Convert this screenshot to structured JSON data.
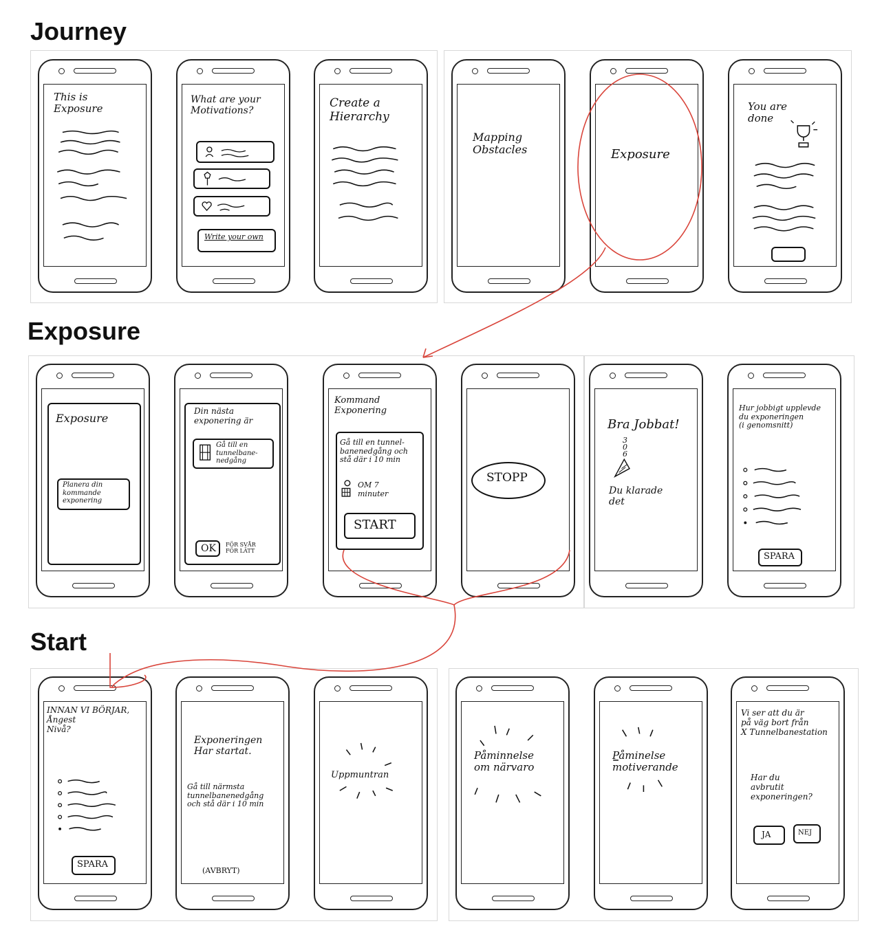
{
  "sections": {
    "journey": "Journey",
    "exposure": "Exposure",
    "start": "Start"
  },
  "accent_color": "#d9443a",
  "journey": {
    "s1_title": "This is\n   Exposure",
    "s2_title": "What are your\n Motivations?",
    "s2_write": "Write your own",
    "s3_title": "Create a\n   Hierarchy",
    "s4_title": "Mapping\n Obstacles",
    "s5_title": "Exposure",
    "s6_title": "You are\n  done"
  },
  "exposure": {
    "s1_title": "Exposure",
    "s1_button": "Planera din\nkommande\nexponering",
    "s2_title": "Din nästa\nexponering är",
    "s2_card": "Gå till en\ntunnelbane-\nnedgång",
    "s2_ok": "OK",
    "s2_options": "FÖR SVÅR\nFÖR LÄTT",
    "s3_title": "Kommand\n  Exponering",
    "s3_task": "Gå till en tunnel-\nbanenedgång och\nstå där i 10 min",
    "s3_timer": "OM 7\nminuter",
    "s3_start": "START",
    "s4_stop": "STOPP",
    "s5_title": "Bra Jobbat!",
    "s5_count": "3\n  0\n    6",
    "s5_sub": "Du klarade\ndet",
    "s6_title": "Hur jobbigt upplevde\ndu exponeringen\n(i genomsnitt)",
    "s6_save": "SPARA"
  },
  "start": {
    "s1_title": "INNAN VI BÖRJAR,\nÅngest\n  Nivå?",
    "s1_save": "SPARA",
    "s2_title": "Exponeringen\nHar startat.",
    "s2_body": "Gå till närmsta\ntunnelbanenedgång\noch stå där i 10 min",
    "s2_cancel": "(AVBRYT)",
    "s3_text": "Uppmuntran",
    "s4_text": "Påminnelse\nom närvaro",
    "s5_text": "Påminelse\nmotiverande",
    "s6_text1": "Vi ser att du är\npå väg bort från\nX Tunnelbanestation",
    "s6_text2": "Har du\navbrutit\nexponeringen?",
    "s6_yes": "JA",
    "s6_no": "NEJ"
  }
}
